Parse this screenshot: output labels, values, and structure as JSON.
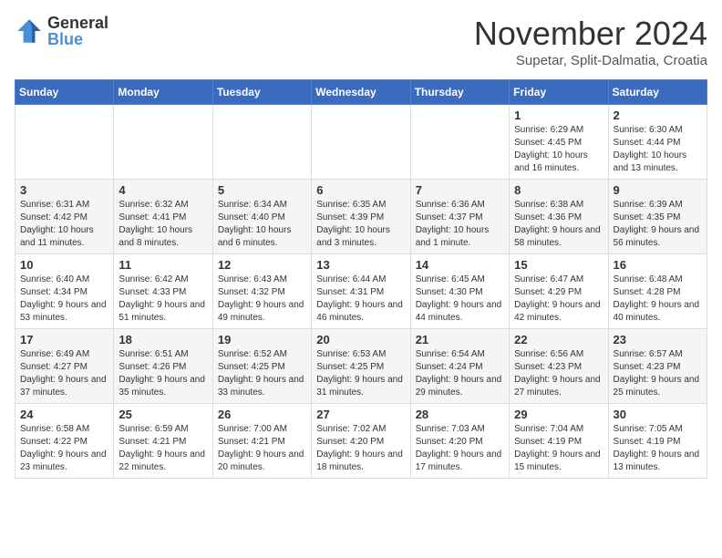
{
  "header": {
    "logo_line1": "General",
    "logo_line2": "Blue",
    "month": "November 2024",
    "location": "Supetar, Split-Dalmatia, Croatia"
  },
  "weekdays": [
    "Sunday",
    "Monday",
    "Tuesday",
    "Wednesday",
    "Thursday",
    "Friday",
    "Saturday"
  ],
  "weeks": [
    [
      {
        "day": "",
        "info": ""
      },
      {
        "day": "",
        "info": ""
      },
      {
        "day": "",
        "info": ""
      },
      {
        "day": "",
        "info": ""
      },
      {
        "day": "",
        "info": ""
      },
      {
        "day": "1",
        "info": "Sunrise: 6:29 AM\nSunset: 4:45 PM\nDaylight: 10 hours and 16 minutes."
      },
      {
        "day": "2",
        "info": "Sunrise: 6:30 AM\nSunset: 4:44 PM\nDaylight: 10 hours and 13 minutes."
      }
    ],
    [
      {
        "day": "3",
        "info": "Sunrise: 6:31 AM\nSunset: 4:42 PM\nDaylight: 10 hours and 11 minutes."
      },
      {
        "day": "4",
        "info": "Sunrise: 6:32 AM\nSunset: 4:41 PM\nDaylight: 10 hours and 8 minutes."
      },
      {
        "day": "5",
        "info": "Sunrise: 6:34 AM\nSunset: 4:40 PM\nDaylight: 10 hours and 6 minutes."
      },
      {
        "day": "6",
        "info": "Sunrise: 6:35 AM\nSunset: 4:39 PM\nDaylight: 10 hours and 3 minutes."
      },
      {
        "day": "7",
        "info": "Sunrise: 6:36 AM\nSunset: 4:37 PM\nDaylight: 10 hours and 1 minute."
      },
      {
        "day": "8",
        "info": "Sunrise: 6:38 AM\nSunset: 4:36 PM\nDaylight: 9 hours and 58 minutes."
      },
      {
        "day": "9",
        "info": "Sunrise: 6:39 AM\nSunset: 4:35 PM\nDaylight: 9 hours and 56 minutes."
      }
    ],
    [
      {
        "day": "10",
        "info": "Sunrise: 6:40 AM\nSunset: 4:34 PM\nDaylight: 9 hours and 53 minutes."
      },
      {
        "day": "11",
        "info": "Sunrise: 6:42 AM\nSunset: 4:33 PM\nDaylight: 9 hours and 51 minutes."
      },
      {
        "day": "12",
        "info": "Sunrise: 6:43 AM\nSunset: 4:32 PM\nDaylight: 9 hours and 49 minutes."
      },
      {
        "day": "13",
        "info": "Sunrise: 6:44 AM\nSunset: 4:31 PM\nDaylight: 9 hours and 46 minutes."
      },
      {
        "day": "14",
        "info": "Sunrise: 6:45 AM\nSunset: 4:30 PM\nDaylight: 9 hours and 44 minutes."
      },
      {
        "day": "15",
        "info": "Sunrise: 6:47 AM\nSunset: 4:29 PM\nDaylight: 9 hours and 42 minutes."
      },
      {
        "day": "16",
        "info": "Sunrise: 6:48 AM\nSunset: 4:28 PM\nDaylight: 9 hours and 40 minutes."
      }
    ],
    [
      {
        "day": "17",
        "info": "Sunrise: 6:49 AM\nSunset: 4:27 PM\nDaylight: 9 hours and 37 minutes."
      },
      {
        "day": "18",
        "info": "Sunrise: 6:51 AM\nSunset: 4:26 PM\nDaylight: 9 hours and 35 minutes."
      },
      {
        "day": "19",
        "info": "Sunrise: 6:52 AM\nSunset: 4:25 PM\nDaylight: 9 hours and 33 minutes."
      },
      {
        "day": "20",
        "info": "Sunrise: 6:53 AM\nSunset: 4:25 PM\nDaylight: 9 hours and 31 minutes."
      },
      {
        "day": "21",
        "info": "Sunrise: 6:54 AM\nSunset: 4:24 PM\nDaylight: 9 hours and 29 minutes."
      },
      {
        "day": "22",
        "info": "Sunrise: 6:56 AM\nSunset: 4:23 PM\nDaylight: 9 hours and 27 minutes."
      },
      {
        "day": "23",
        "info": "Sunrise: 6:57 AM\nSunset: 4:23 PM\nDaylight: 9 hours and 25 minutes."
      }
    ],
    [
      {
        "day": "24",
        "info": "Sunrise: 6:58 AM\nSunset: 4:22 PM\nDaylight: 9 hours and 23 minutes."
      },
      {
        "day": "25",
        "info": "Sunrise: 6:59 AM\nSunset: 4:21 PM\nDaylight: 9 hours and 22 minutes."
      },
      {
        "day": "26",
        "info": "Sunrise: 7:00 AM\nSunset: 4:21 PM\nDaylight: 9 hours and 20 minutes."
      },
      {
        "day": "27",
        "info": "Sunrise: 7:02 AM\nSunset: 4:20 PM\nDaylight: 9 hours and 18 minutes."
      },
      {
        "day": "28",
        "info": "Sunrise: 7:03 AM\nSunset: 4:20 PM\nDaylight: 9 hours and 17 minutes."
      },
      {
        "day": "29",
        "info": "Sunrise: 7:04 AM\nSunset: 4:19 PM\nDaylight: 9 hours and 15 minutes."
      },
      {
        "day": "30",
        "info": "Sunrise: 7:05 AM\nSunset: 4:19 PM\nDaylight: 9 hours and 13 minutes."
      }
    ]
  ]
}
